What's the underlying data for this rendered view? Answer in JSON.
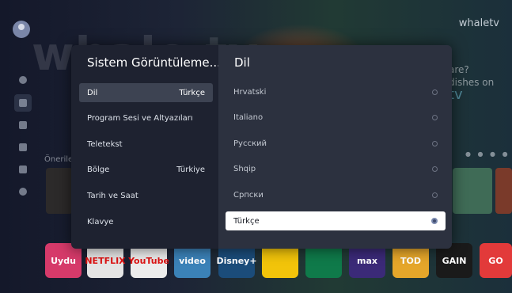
{
  "background": {
    "brand_top": "whaletv",
    "brand_big": "whale tv",
    "promo_line1": "are?",
    "promo_line2": "dishes on",
    "promo_tv": "tv",
    "recommendations_label": "Öneriler",
    "apps": [
      {
        "label": "Uydu",
        "color": "#d63a6a"
      },
      {
        "label": "NETFLIX",
        "color": "#e4e4e4"
      },
      {
        "label": "YouTube",
        "color": "#ececec"
      },
      {
        "label": "video",
        "color": "#3b82b8"
      },
      {
        "label": "Disney+",
        "color": "#1b4c7a"
      },
      {
        "label": "",
        "color": "#f2c40a"
      },
      {
        "label": "",
        "color": "#0f7a4a"
      },
      {
        "label": "max",
        "color": "#3b2a78"
      },
      {
        "label": "TOD",
        "color": "#e5a62a"
      },
      {
        "label": "GAIN",
        "color": "#1a1a1a"
      },
      {
        "label": "GO",
        "color": "#e23a3a"
      }
    ]
  },
  "dialog": {
    "left_title": "Sistem Görüntüleme...",
    "menu": [
      {
        "label": "Dil",
        "value": "Türkçe",
        "selected": true
      },
      {
        "label": "Program Sesi ve Altyazıları",
        "value": "",
        "selected": false
      },
      {
        "label": "Teletekst",
        "value": "",
        "selected": false
      },
      {
        "label": "Bölge",
        "value": "Türkiye",
        "selected": false
      },
      {
        "label": "Tarih ve Saat",
        "value": "",
        "selected": false
      },
      {
        "label": "Klavye",
        "value": "",
        "selected": false
      }
    ],
    "right_title": "Dil",
    "languages": [
      {
        "label": "Hrvatski",
        "selected": false
      },
      {
        "label": "Italiano",
        "selected": false
      },
      {
        "label": "Русский",
        "selected": false
      },
      {
        "label": "Shqip",
        "selected": false
      },
      {
        "label": "Српски",
        "selected": false
      },
      {
        "label": "Türkçe",
        "selected": true
      }
    ]
  }
}
